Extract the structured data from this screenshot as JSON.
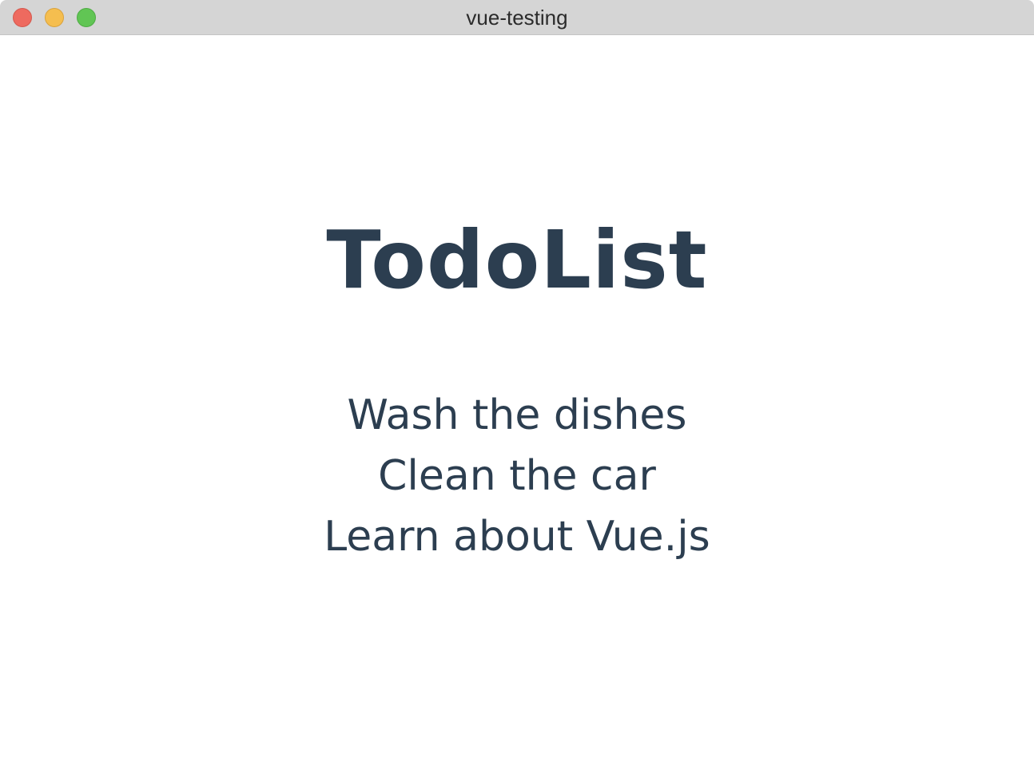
{
  "window": {
    "title": "vue-testing"
  },
  "app": {
    "title": "TodoList",
    "todos": [
      {
        "text": "Wash the dishes"
      },
      {
        "text": "Clean the car"
      },
      {
        "text": "Learn about Vue.js"
      }
    ]
  },
  "colors": {
    "text": "#2c3e50",
    "titlebar": "#d5d5d5",
    "close": "#ee6a5f",
    "minimize": "#f5be4f",
    "maximize": "#61c554"
  }
}
